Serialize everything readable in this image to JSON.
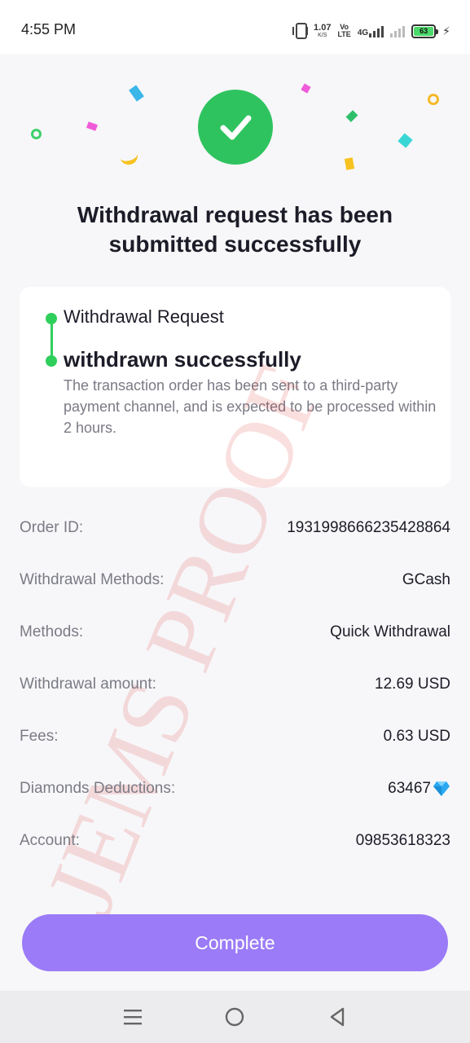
{
  "status_bar": {
    "time": "4:55 PM",
    "net_speed_value": "1.07",
    "net_speed_unit": "K/S",
    "volte_top": "Vo",
    "volte_bottom": "LTE",
    "network_type": "4G",
    "battery_level": "63"
  },
  "header": {
    "title": "Withdrawal request has been submitted successfully"
  },
  "progress": {
    "step1_label": "Withdrawal Request",
    "step2_label": "withdrawn successfully",
    "step2_description": "The transaction order has been sent to a third-party payment channel, and is expected to be processed within 2 hours."
  },
  "details": [
    {
      "label": "Order ID:",
      "value": "1931998666235428864"
    },
    {
      "label": "Withdrawal Methods:",
      "value": "GCash"
    },
    {
      "label": "Methods:",
      "value": "Quick Withdrawal"
    },
    {
      "label": "Withdrawal amount:",
      "value": "12.69 USD"
    },
    {
      "label": "Fees:",
      "value": "0.63 USD"
    },
    {
      "label": "Diamonds Deductions:",
      "value": "63467"
    },
    {
      "label": "Account:",
      "value": "09853618323"
    }
  ],
  "complete_label": "Complete",
  "watermark": "JEMS PROOF",
  "colors": {
    "success_green": "#2fc35f",
    "button_purple": "#9b7bf7",
    "watermark_red": "#e23b3b"
  },
  "icons": {
    "success": "check-icon",
    "diamond": "diamond-icon",
    "nav_menu": "menu-icon",
    "nav_home": "home-circle-icon",
    "nav_back": "back-triangle-icon"
  }
}
